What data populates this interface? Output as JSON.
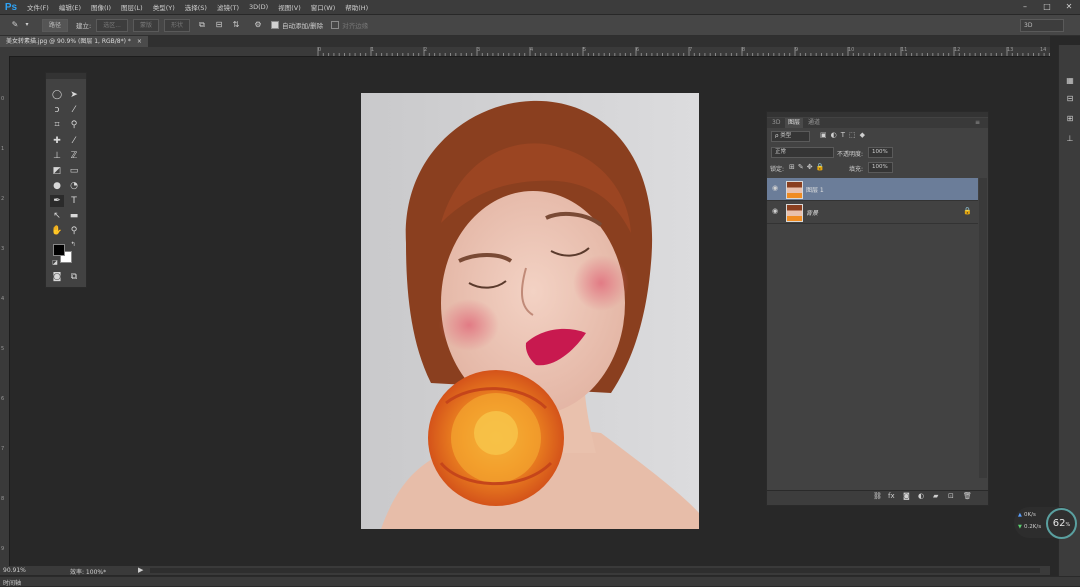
{
  "app": {
    "logo": "Ps"
  },
  "menu": [
    "文件(F)",
    "编辑(E)",
    "图像(I)",
    "图层(L)",
    "类型(Y)",
    "选择(S)",
    "滤镜(T)",
    "3D(D)",
    "视图(V)",
    "窗口(W)",
    "帮助(H)"
  ],
  "window_controls": {
    "min": "–",
    "max": "□",
    "close": "✕"
  },
  "options": {
    "mode": "路径",
    "make_label": "建立:",
    "selection_btn": "选区...",
    "mask_btn": "蒙版",
    "shape_btn": "形状",
    "auto_add_label": "自动添加/删除",
    "align_edges_label": "对齐边缘",
    "workspace": "3D"
  },
  "document": {
    "tab_label": "美女转素描.jpg @ 90.9% (图层 1, RGB/8*) *",
    "close": "×"
  },
  "rulers": {
    "top": [
      "0",
      "1",
      "2",
      "3",
      "4",
      "5",
      "6",
      "7",
      "8",
      "9",
      "10",
      "11",
      "12",
      "13",
      "14"
    ],
    "left": [
      "0",
      "1",
      "2",
      "3",
      "4",
      "5",
      "6",
      "7",
      "8",
      "9"
    ]
  },
  "layers_panel": {
    "tabs": [
      "3D",
      "图层",
      "通道"
    ],
    "kind_filter": "ρ 类型",
    "blend_mode": "正常",
    "opacity_label": "不透明度:",
    "opacity_value": "100%",
    "lock_label": "锁定:",
    "fill_label": "填充:",
    "fill_value": "100%",
    "layers": [
      {
        "name": "图层 1",
        "selected": true,
        "locked": false
      },
      {
        "name": "背景",
        "selected": false,
        "locked": true
      }
    ]
  },
  "status": {
    "zoom": "90.91%",
    "efficiency": "效率: 100%*"
  },
  "bottom": {
    "label": "时间轴"
  },
  "net_widget": {
    "upload": "0K/s",
    "download": "0.2K/s",
    "percent": "62"
  },
  "colors": {
    "accent": "#2fa3f5",
    "selected_layer": "#6b7d99",
    "foreground": "#000000",
    "background": "#ffffff"
  }
}
